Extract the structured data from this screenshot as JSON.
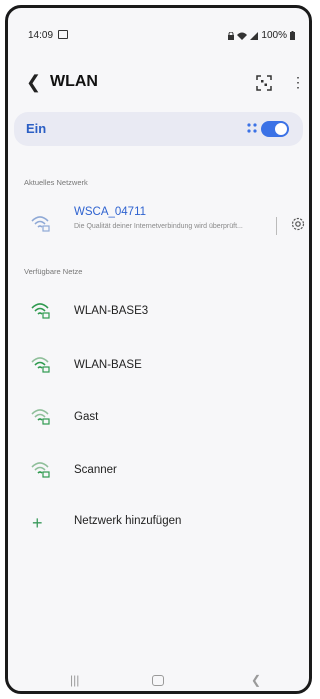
{
  "status": {
    "time": "14:09",
    "battery": "100%"
  },
  "header": {
    "title": "WLAN",
    "back_icon": "back-arrow-icon",
    "scan_icon": "qr-scan-icon",
    "more_icon": "more-vert-icon"
  },
  "wifi_toggle": {
    "label": "Ein",
    "enabled": true,
    "accent": "#3b72e6"
  },
  "current": {
    "section_title": "Aktuelles Netzwerk",
    "network_name": "WSCA_04711",
    "description": "Die Qualität deiner Internetverbindung wird überprüft..."
  },
  "available": {
    "section_title": "Verfügbare Netze",
    "networks": [
      {
        "name": "WLAN-BASE3"
      },
      {
        "name": "WLAN-BASE"
      },
      {
        "name": "Gast"
      },
      {
        "name": "Scanner"
      }
    ]
  },
  "add_network": {
    "label": "Netzwerk hinzufügen"
  },
  "navbar": {
    "recent_icon": "recent-apps-icon",
    "home_icon": "home-icon",
    "back_icon": "nav-back-icon"
  }
}
